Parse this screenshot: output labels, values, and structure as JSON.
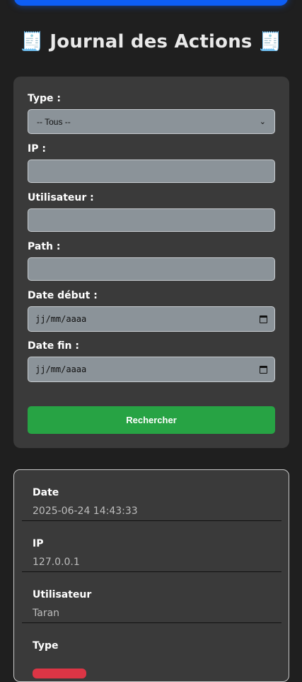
{
  "header": {
    "title": "Journal des Actions",
    "title_icon": "🧾"
  },
  "filters": {
    "type_label": "Type :",
    "type_selected": "-- Tous --",
    "ip_label": "IP :",
    "ip_value": "",
    "user_label": "Utilisateur :",
    "user_value": "",
    "path_label": "Path :",
    "path_value": "",
    "date_start_label": "Date début :",
    "date_start_placeholder": "jj/mm/aaaa",
    "date_end_label": "Date fin :",
    "date_end_placeholder": "jj/mm/aaaa",
    "search_label": "Rechercher"
  },
  "result": {
    "date_label": "Date",
    "date_value": "2025-06-24 14:43:33",
    "ip_label": "IP",
    "ip_value": "127.0.0.1",
    "user_label": "Utilisateur",
    "user_value": "Taran",
    "type_label": "Type"
  },
  "colors": {
    "background": "#1f1f1f",
    "panel": "#3a3a3a",
    "accent_blue": "#0d5ef5",
    "search_green": "#27a344",
    "badge_red": "#dc3545"
  }
}
